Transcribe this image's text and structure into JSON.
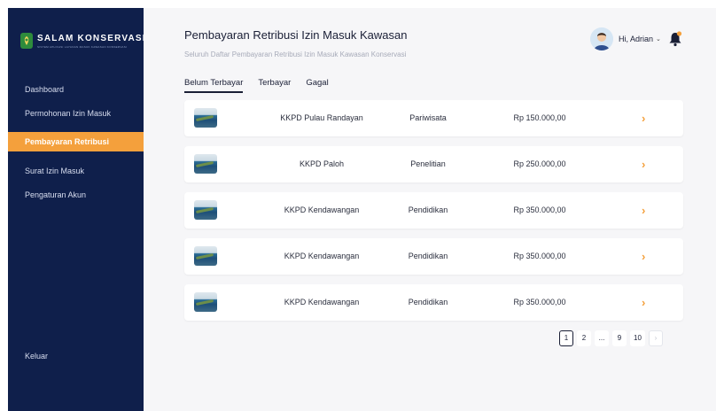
{
  "brand": {
    "name": "SALAM KONSERVASI",
    "tagline": "SISTEM APLIKASI LAYANAN MASUK KAWASAN KONSERVASI"
  },
  "sidebar": {
    "items": [
      {
        "label": "Dashboard",
        "active": false
      },
      {
        "label": "Permohonan Izin Masuk",
        "active": false
      },
      {
        "label": "Pembayaran Retribusi",
        "active": true
      },
      {
        "label": "Surat Izin Masuk",
        "active": false
      },
      {
        "label": "Pengaturan Akun",
        "active": false
      }
    ],
    "logout_label": "Keluar"
  },
  "header": {
    "title": "Pembayaran Retribusi Izin Masuk Kawasan",
    "subtitle": "Seluruh Daftar Pembayaran Retribusi Izin Masuk Kawasan Konservasi",
    "greeting": "Hi, Adrian"
  },
  "tabs": [
    {
      "label": "Belum Terbayar",
      "active": true
    },
    {
      "label": "Terbayar",
      "active": false
    },
    {
      "label": "Gagal",
      "active": false
    }
  ],
  "rows": [
    {
      "location": "KKPD Pulau Randayan",
      "category": "Pariwisata",
      "amount": "Rp 150.000,00"
    },
    {
      "location": "KKPD Paloh",
      "category": "Penelitian",
      "amount": "Rp 250.000,00"
    },
    {
      "location": "KKPD Kendawangan",
      "category": "Pendidikan",
      "amount": "Rp 350.000,00"
    },
    {
      "location": "KKPD Kendawangan",
      "category": "Pendidikan",
      "amount": "Rp 350.000,00"
    },
    {
      "location": "KKPD Kendawangan",
      "category": "Pendidikan",
      "amount": "Rp 350.000,00"
    }
  ],
  "pagination": {
    "pages": [
      "1",
      "2",
      "...",
      "9",
      "10"
    ],
    "current": "1",
    "next_icon": "chevron-right-icon"
  },
  "icons": {
    "arrow": "chevron-right-icon",
    "bell": "bell-icon",
    "user_menu": "chevron-down-icon"
  },
  "colors": {
    "sidebar_bg": "#0f1f4b",
    "accent": "#f4a03c",
    "content_bg": "#f6f6f8"
  }
}
